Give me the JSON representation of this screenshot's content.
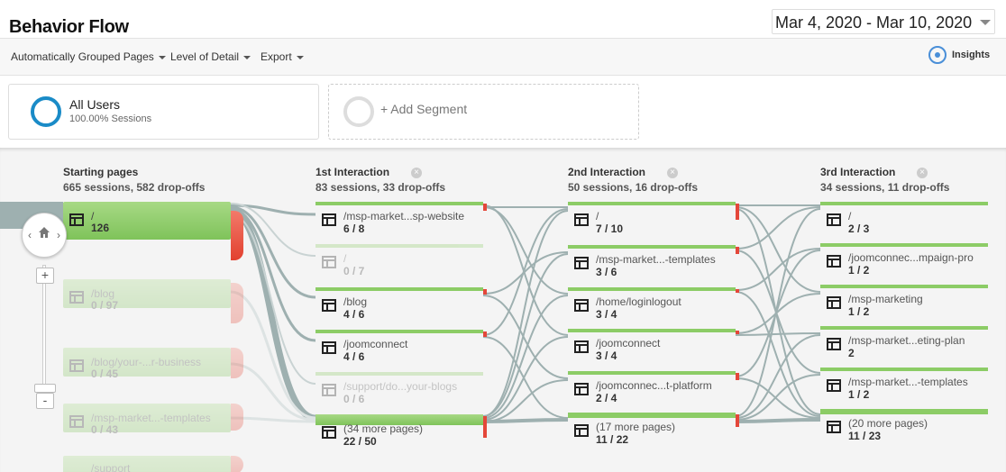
{
  "header": {
    "title": "Behavior Flow",
    "date_range": "Mar 4, 2020 - Mar 10, 2020"
  },
  "toolbar": {
    "grouping_label": "Automatically Grouped Pages",
    "detail_label": "Level of Detail",
    "export_label": "Export",
    "insights_label": "Insights"
  },
  "segments": {
    "active_name": "All Users",
    "active_sub": "100.00% Sessions",
    "add_label": "+ Add Segment",
    "accent_color": "#1a8bc7"
  },
  "colors": {
    "node_green": "#8ccc66",
    "dropoff_red": "#e4473a",
    "link_gray": "#9fb1b1"
  },
  "flow": {
    "starting": {
      "title": "Starting pages",
      "sub": "665 sessions, 582 drop-offs",
      "nodes": [
        {
          "label": "/",
          "count": "126"
        },
        {
          "label": "/blog",
          "count": "0 / 97"
        },
        {
          "label": "/blog/your-...r-business",
          "count": "0 / 45"
        },
        {
          "label": "/msp-market...-templates",
          "count": "0 / 43"
        },
        {
          "label": "/support",
          "count": ""
        }
      ]
    },
    "int1": {
      "title": "1st Interaction",
      "sub": "83 sessions, 33 drop-offs",
      "nodes": [
        {
          "label": "/msp-market...sp-website",
          "count": "6 / 8"
        },
        {
          "label": "/",
          "count": "0 / 7"
        },
        {
          "label": "/blog",
          "count": "4 / 6"
        },
        {
          "label": "/joomconnect",
          "count": "4 / 6"
        },
        {
          "label": "/support/do...your-blogs",
          "count": "0 / 6"
        },
        {
          "label": "(34 more pages)",
          "count": "22 / 50"
        }
      ]
    },
    "int2": {
      "title": "2nd Interaction",
      "sub": "50 sessions, 16 drop-offs",
      "nodes": [
        {
          "label": "/",
          "count": "7 / 10"
        },
        {
          "label": "/msp-market...-templates",
          "count": "3 / 6"
        },
        {
          "label": "/home/loginlogout",
          "count": "3 / 4"
        },
        {
          "label": "/joomconnect",
          "count": "3 / 4"
        },
        {
          "label": "/joomconnec...t-platform",
          "count": "2 / 4"
        },
        {
          "label": "(17 more pages)",
          "count": "11 / 22"
        }
      ]
    },
    "int3": {
      "title": "3rd Interaction",
      "sub": "34 sessions, 11 drop-offs",
      "nodes": [
        {
          "label": "/",
          "count": "2 / 3"
        },
        {
          "label": "/joomconnec...mpaign-pro",
          "count": "1 / 2"
        },
        {
          "label": "/msp-marketing",
          "count": "1 / 2"
        },
        {
          "label": "/msp-market...eting-plan",
          "count": "2"
        },
        {
          "label": "/msp-market...-templates",
          "count": "1 / 2"
        },
        {
          "label": "(20 more pages)",
          "count": "11 / 23"
        }
      ]
    }
  },
  "zoom": {
    "plus": "+",
    "minus": "-",
    "left_arrow": "‹",
    "right_arrow": "›"
  }
}
